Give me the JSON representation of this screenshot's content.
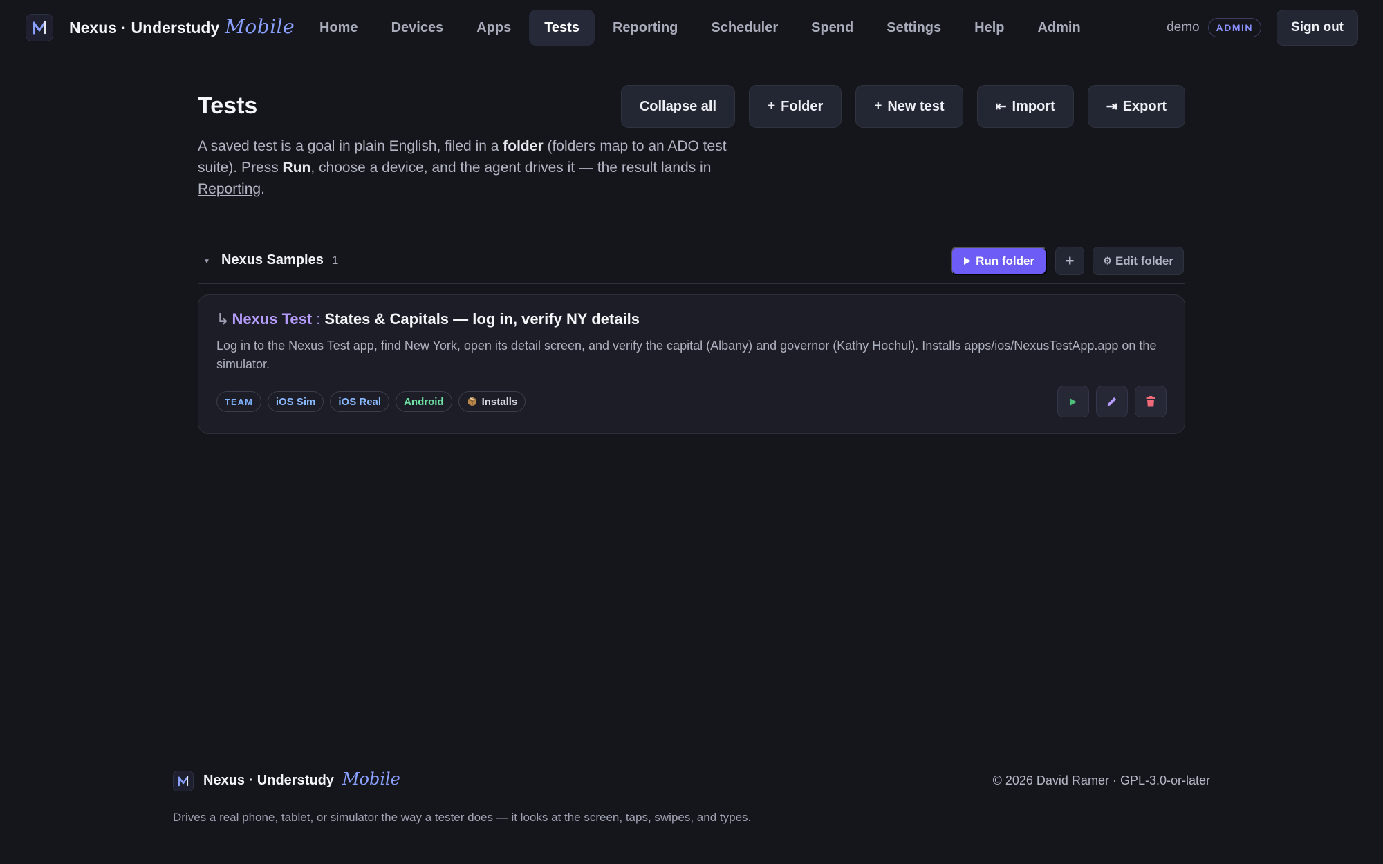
{
  "brand": {
    "name": "Nexus · Understudy",
    "script": "Mobile"
  },
  "nav": {
    "items": [
      {
        "label": "Home"
      },
      {
        "label": "Devices"
      },
      {
        "label": "Apps"
      },
      {
        "label": "Tests",
        "active": true
      },
      {
        "label": "Reporting"
      },
      {
        "label": "Scheduler"
      },
      {
        "label": "Spend"
      },
      {
        "label": "Settings"
      },
      {
        "label": "Help"
      },
      {
        "label": "Admin"
      }
    ]
  },
  "user": {
    "name": "demo",
    "role": "ADMIN",
    "signout_label": "Sign out"
  },
  "page": {
    "title": "Tests",
    "intro": {
      "p1": "A saved test is a goal in plain English, filed in a ",
      "folder_word": "folder",
      "p2": " (folders map to an ADO test suite). Press ",
      "run_word": "Run",
      "p3": ", choose a device, and the agent drives it — the result lands in ",
      "link": "Reporting",
      "p4": "."
    },
    "actions": {
      "collapse_all": "Collapse all",
      "folder": "Folder",
      "new_test": "New test",
      "import": "Import",
      "export": "Export"
    }
  },
  "folder": {
    "name": "Nexus Samples",
    "count": "1",
    "run_folder": "Run folder",
    "add_label": "+",
    "edit_folder": "Edit folder"
  },
  "test": {
    "app": "Nexus Test",
    "separator": ":",
    "name": "States & Capitals — log in, verify NY details",
    "description": "Log in to the Nexus Test app, find New York, open its detail screen, and verify the capital (Albany) and governor (Kathy Hochul). Installs apps/ios/NexusTestApp.app on the simulator.",
    "tags": {
      "team": "TEAM",
      "ios_sim": "iOS Sim",
      "ios_real": "iOS Real",
      "android": "Android",
      "installs": "Installs"
    }
  },
  "footer": {
    "name": "Nexus · Understudy",
    "script": "Mobile",
    "copyright": "© 2026 David Ramer · GPL-3.0-or-later",
    "tagline": "Drives a real phone, tablet, or simulator the way a tester does — it looks at the screen, taps, swipes, and types."
  },
  "colors": {
    "background": "#15161c",
    "accent": "#6d5cf6",
    "app_name": "#b79cff",
    "brand_script": "#8aa0ff",
    "android": "#6fe3a5",
    "delete": "#f06a7a",
    "run": "#4ec07a"
  },
  "icons": {
    "logo": "nexus-logo-icon",
    "run": "play-icon",
    "edit": "pencil-icon",
    "delete": "trash-icon",
    "installs": "package-icon"
  }
}
